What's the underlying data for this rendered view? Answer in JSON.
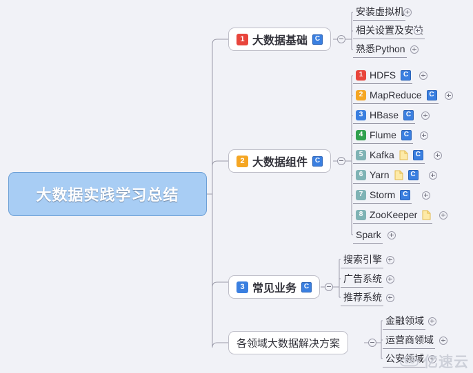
{
  "root": {
    "label": "大数据实践学习总结"
  },
  "branches": [
    {
      "label": "大数据基础",
      "badge": "1",
      "badge_color": "#e8453c",
      "has_c_icon": true,
      "toggle": "minus",
      "children": [
        {
          "label": "安装虚拟机",
          "toggle": "plus"
        },
        {
          "label": "相关设置及安装",
          "toggle": "plus"
        },
        {
          "label": "熟悉Python",
          "toggle": "plus"
        }
      ]
    },
    {
      "label": "大数据组件",
      "badge": "2",
      "badge_color": "#f5a623",
      "has_c_icon": true,
      "toggle": "minus",
      "children": [
        {
          "label": "HDFS",
          "badge": "1",
          "badge_color": "#e8453c",
          "has_c_icon": true,
          "has_note_icon": false,
          "toggle": "plus"
        },
        {
          "label": "MapReduce",
          "badge": "2",
          "badge_color": "#f5a623",
          "has_c_icon": true,
          "has_note_icon": false,
          "toggle": "plus"
        },
        {
          "label": "HBase",
          "badge": "3",
          "badge_color": "#3a7fe0",
          "has_c_icon": true,
          "has_note_icon": false,
          "toggle": "plus"
        },
        {
          "label": "Flume",
          "badge": "4",
          "badge_color": "#30a14e",
          "has_c_icon": true,
          "has_note_icon": false,
          "toggle": "plus"
        },
        {
          "label": "Kafka",
          "badge": "5",
          "badge_color": "#7fb3b5",
          "has_c_icon": true,
          "has_note_icon": true,
          "toggle": "plus"
        },
        {
          "label": "Yarn",
          "badge": "6",
          "badge_color": "#7fb3b5",
          "has_c_icon": true,
          "has_note_icon": true,
          "toggle": "plus"
        },
        {
          "label": "Storm",
          "badge": "7",
          "badge_color": "#7fb3b5",
          "has_c_icon": true,
          "has_note_icon": false,
          "toggle": "plus"
        },
        {
          "label": "ZooKeeper",
          "badge": "8",
          "badge_color": "#7fb3b5",
          "has_c_icon": false,
          "has_note_icon": true,
          "toggle": "plus"
        },
        {
          "label": "Spark",
          "badge": "",
          "badge_color": "",
          "has_c_icon": false,
          "has_note_icon": false,
          "toggle": "plus"
        }
      ]
    },
    {
      "label": "常见业务",
      "badge": "3",
      "badge_color": "#3a7fe0",
      "has_c_icon": true,
      "toggle": "minus",
      "children": [
        {
          "label": "搜索引擎",
          "toggle": "plus"
        },
        {
          "label": "广告系统",
          "toggle": "plus"
        },
        {
          "label": "推荐系统",
          "toggle": "plus"
        }
      ]
    },
    {
      "label": "各领域大数据解决方案",
      "badge": "",
      "badge_color": "",
      "has_c_icon": false,
      "toggle": "minus",
      "children": [
        {
          "label": "金融领域",
          "toggle": "plus"
        },
        {
          "label": "运营商领域",
          "toggle": "plus"
        },
        {
          "label": "公安领域",
          "toggle": "plus"
        }
      ]
    }
  ],
  "watermark": {
    "text": "亿速云",
    "icon": "cloud-icon"
  },
  "colors": {
    "background": "#f1f2f7",
    "root_fill": "#a8cdf4",
    "root_border": "#6c9fd6",
    "line": "#9a9aa8",
    "node_border": "#bfbfc9"
  }
}
